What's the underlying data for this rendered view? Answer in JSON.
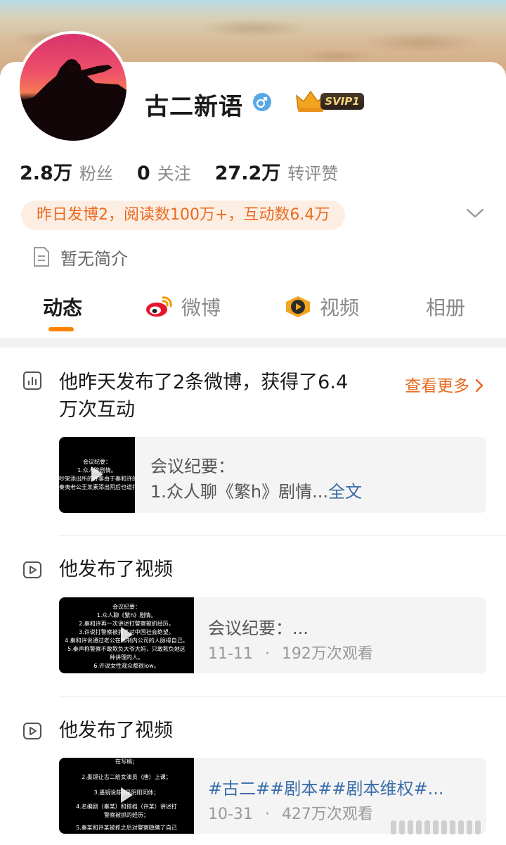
{
  "profile": {
    "name": "古二新语",
    "gender_icon": "male-icon",
    "vip_badge": "SVIP1",
    "stats": [
      {
        "value": "2.8万",
        "label": "粉丝"
      },
      {
        "value": "0",
        "label": "关注"
      },
      {
        "value": "27.2万",
        "label": "转评赞"
      }
    ],
    "summary": "昨日发博2，阅读数100万+，互动数6.4万",
    "bio": "暂无简介"
  },
  "tabs": [
    {
      "label": "动态",
      "icon": null,
      "active": true
    },
    {
      "label": "微博",
      "icon": "weibo-logo-icon",
      "active": false
    },
    {
      "label": "视频",
      "icon": "video-play-icon",
      "active": false
    },
    {
      "label": "相册",
      "icon": null,
      "active": false
    }
  ],
  "feed": {
    "stats_item": {
      "title_line1": "他昨天发布了2条微博，获得了6.4",
      "title_line2": "万次互动",
      "see_more": "查看更多",
      "card_line1": "会议纪要：",
      "card_line2": "1.众人聊《繁h》剧情...",
      "full_text_link": "全文",
      "thumb_lines": [
        "会议纪要：",
        "1.众人聊剧情。",
        "吵架添出所的好事由于秦和许的经",
        "秦夷老公王某素添出阴后也道打警察"
      ]
    },
    "video_item_1": {
      "title": "他发布了视频",
      "card_line1": "会议纪要：...",
      "date": "11-11",
      "views": "192万次观看",
      "thumb_lines": [
        "会议纪要：",
        "1.众人聊《繁h》剧情。",
        "2.秦和许再一次讲述打警察被抓经历。",
        "3.许说打警察被抓了对中国社会绝望。",
        "4.秦和许说通过老公在体制内公司的人脉得自己。",
        "5.秦声称警察不敢欺负大爷大妈，只敢欺负她这",
        "种讲理的人。",
        "6.许说女性观众都很low。"
      ]
    },
    "video_item_2": {
      "title": "他发布了视频",
      "hashtags": "#古二##剧本##剧本维权#...",
      "date": "10-31",
      "views": "427万次观看",
      "thumb_lines": [
        "在写稿；",
        "2.墨镜让古二给女演员（唐）上课；",
        "3.墨镜说陈d是阴阳同体；",
        "4.名编剧（秦某）和搭档（许某）讲述打",
        "警察被抓的经历；",
        "5.秦某和许某被抓之后对警察隐瞒了自己"
      ]
    },
    "separator": "·"
  }
}
